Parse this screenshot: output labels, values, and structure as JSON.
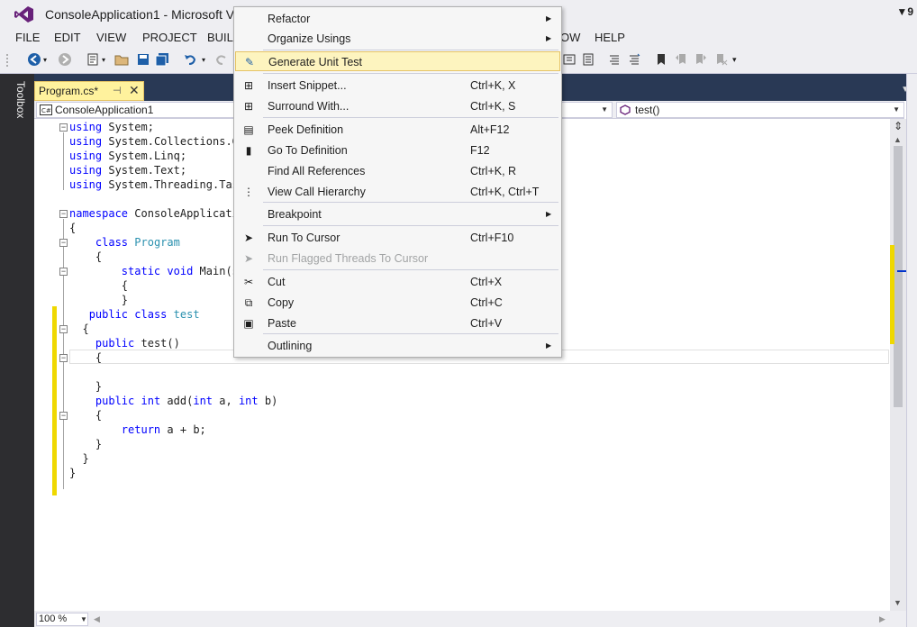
{
  "window": {
    "title": "ConsoleApplication1 - Microsoft Vis",
    "right_indicator": "9"
  },
  "menubar": {
    "items": [
      "FILE",
      "EDIT",
      "VIEW",
      "PROJECT",
      "BUIL",
      "OW",
      "HELP"
    ]
  },
  "toolbox": {
    "label": "Toolbox"
  },
  "doc_tab": {
    "label": "Program.cs*",
    "pin": "⊣",
    "close": "✕"
  },
  "navbar": {
    "project": "ConsoleApplication1",
    "member": "test()"
  },
  "code": {
    "lines": [
      "using System;",
      "using System.Collections.G",
      "using System.Linq;",
      "using System.Text;",
      "using System.Threading.Tas",
      "",
      "namespace ConsoleApplicati",
      "{",
      "    class Program",
      "    {",
      "        static void Main(s",
      "        {",
      "        }",
      "   public class test",
      "  {",
      "    public test()",
      "    {",
      "",
      "    }",
      "    public int add(int a, int b)",
      "    {",
      "        return a + b;",
      "    }",
      "  }",
      "}"
    ]
  },
  "zoom": {
    "value": "100 %"
  },
  "context_menu": {
    "items": [
      {
        "label": "Refactor",
        "shortcut": "",
        "submenu": true,
        "icon": "",
        "icon_name": "none"
      },
      {
        "label": "Organize Usings",
        "shortcut": "",
        "submenu": true,
        "icon": "",
        "icon_name": "none"
      },
      {
        "label": "Generate Unit Test",
        "shortcut": "",
        "submenu": false,
        "icon": "✎",
        "icon_name": "unit-test-icon",
        "highlighted": true
      },
      {
        "label": "Insert Snippet...",
        "shortcut": "Ctrl+K, X",
        "submenu": false,
        "icon": "⊞",
        "icon_name": "snippet-icon"
      },
      {
        "label": "Surround With...",
        "shortcut": "Ctrl+K, S",
        "submenu": false,
        "icon": "⊞",
        "icon_name": "surround-icon"
      },
      {
        "label": "Peek Definition",
        "shortcut": "Alt+F12",
        "submenu": false,
        "icon": "▤",
        "icon_name": "peek-definition-icon"
      },
      {
        "label": "Go To Definition",
        "shortcut": "F12",
        "submenu": false,
        "icon": "▮",
        "icon_name": "go-to-definition-icon"
      },
      {
        "label": "Find All References",
        "shortcut": "Ctrl+K, R",
        "submenu": false,
        "icon": "",
        "icon_name": "none"
      },
      {
        "label": "View Call Hierarchy",
        "shortcut": "Ctrl+K, Ctrl+T",
        "submenu": false,
        "icon": "⋮",
        "icon_name": "call-hierarchy-icon"
      },
      {
        "label": "Breakpoint",
        "shortcut": "",
        "submenu": true,
        "icon": "",
        "icon_name": "none"
      },
      {
        "label": "Run To Cursor",
        "shortcut": "Ctrl+F10",
        "submenu": false,
        "icon": "➤",
        "icon_name": "run-to-cursor-icon"
      },
      {
        "label": "Run Flagged Threads To Cursor",
        "shortcut": "",
        "submenu": false,
        "icon": "➤",
        "icon_name": "run-flagged-threads-icon",
        "disabled": true
      },
      {
        "label": "Cut",
        "shortcut": "Ctrl+X",
        "submenu": false,
        "icon": "✂",
        "icon_name": "cut-icon"
      },
      {
        "label": "Copy",
        "shortcut": "Ctrl+C",
        "submenu": false,
        "icon": "⧉",
        "icon_name": "copy-icon"
      },
      {
        "label": "Paste",
        "shortcut": "Ctrl+V",
        "submenu": false,
        "icon": "▣",
        "icon_name": "paste-icon"
      },
      {
        "label": "Outlining",
        "shortcut": "",
        "submenu": true,
        "icon": "",
        "icon_name": "none"
      }
    ]
  },
  "colors": {
    "accent_purple": "#68217a",
    "keyword_blue": "#0000ff",
    "type_teal": "#2b91af",
    "highlight_yellow": "#fdf4bf",
    "change_bar_yellow": "#efd800",
    "tab_well": "#293955"
  }
}
